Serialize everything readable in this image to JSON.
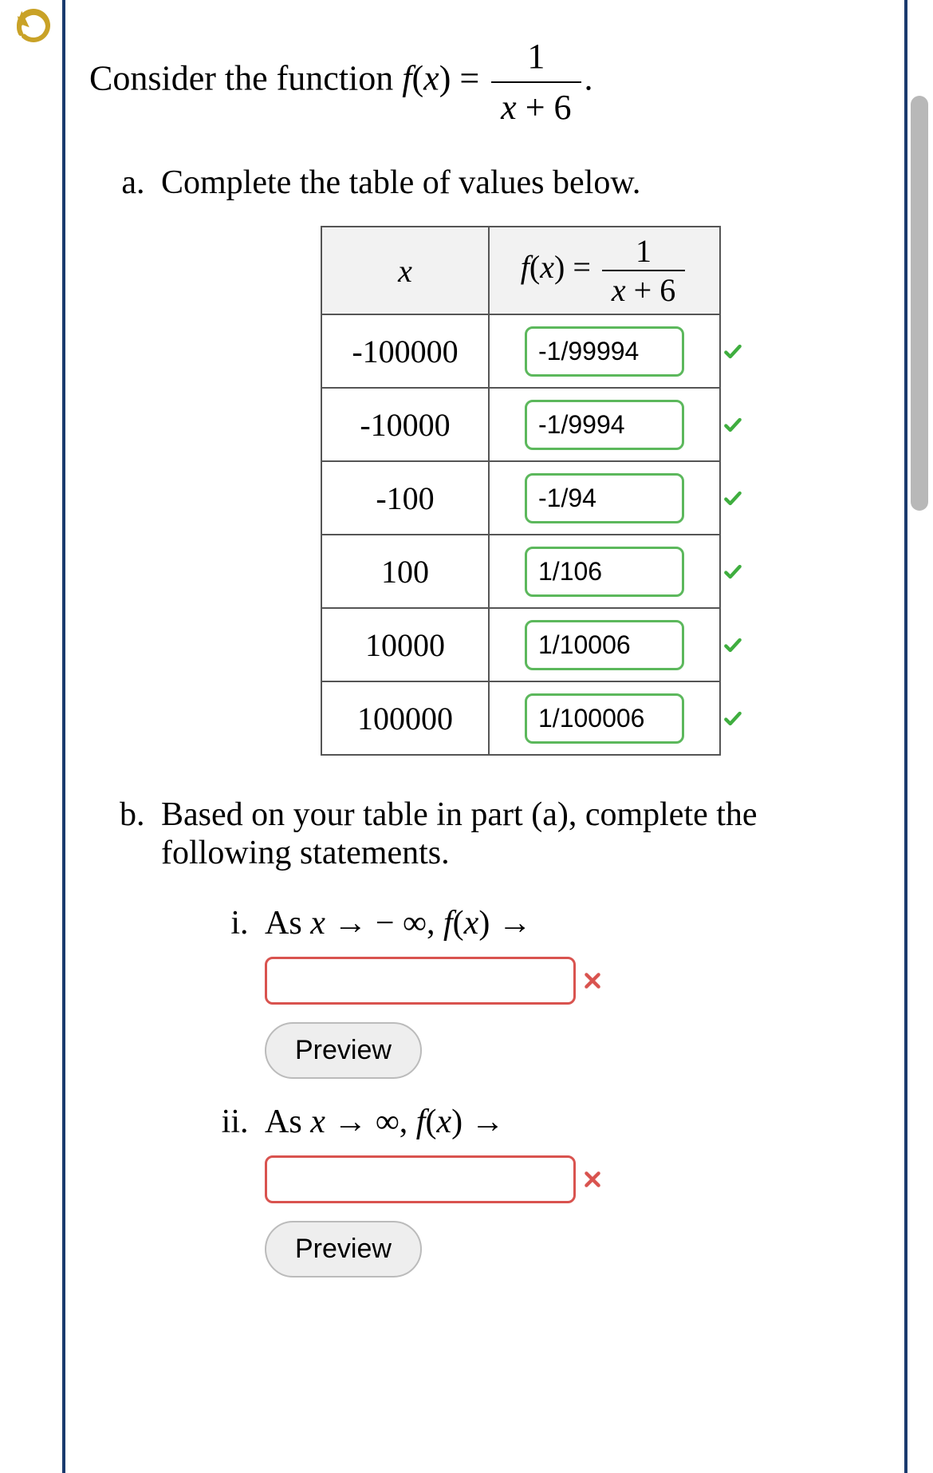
{
  "intro": {
    "prefix": "Consider the function ",
    "func_lhs_f": "f",
    "func_lhs_x": "x",
    "equals": " = ",
    "frac_num": "1",
    "frac_den_x": "x",
    "frac_den_plus": " + 6",
    "period": "."
  },
  "part_a": {
    "text": "Complete the table of values below.",
    "header_x": "x",
    "header_fx_f": "f",
    "header_fx_x": "x",
    "header_eq": " = ",
    "header_frac_num": "1",
    "header_frac_den_x": "x",
    "header_frac_den_plus": " + 6",
    "rows": [
      {
        "x": "-100000",
        "val": "-1/99994"
      },
      {
        "x": "-10000",
        "val": "-1/9994"
      },
      {
        "x": "-100",
        "val": "-1/94"
      },
      {
        "x": "100",
        "val": "1/106"
      },
      {
        "x": "10000",
        "val": "1/10006"
      },
      {
        "x": "100000",
        "val": "1/100006"
      }
    ]
  },
  "part_b": {
    "text": "Based on your table in part (a), complete the following statements.",
    "items": [
      {
        "prefix": "As ",
        "x": "x",
        "arrow1": " → ",
        "neg": " − ∞, ",
        "f": "f",
        "xx": "x",
        "arrow2": " →",
        "value": "",
        "preview": "Preview"
      },
      {
        "prefix": "As ",
        "x": "x",
        "arrow1": " → ∞, ",
        "neg": "",
        "f": "f",
        "xx": "x",
        "arrow2": " →",
        "value": "",
        "preview": "Preview"
      }
    ]
  }
}
